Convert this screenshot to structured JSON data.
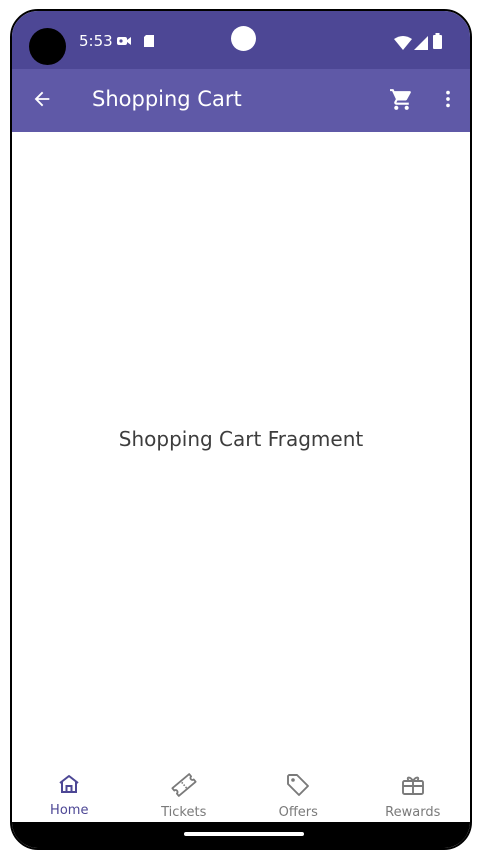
{
  "status_bar": {
    "time": "5:53",
    "left_icons": [
      "media-icon",
      "sd-card-icon"
    ],
    "right_icons": [
      "wifi-icon",
      "signal-icon",
      "battery-icon"
    ]
  },
  "app_bar": {
    "title": "Shopping Cart",
    "back_icon": "arrow-left-icon",
    "actions": [
      "cart-icon",
      "more-vert-icon"
    ]
  },
  "content": {
    "text": "Shopping Cart Fragment"
  },
  "bottom_nav": {
    "items": [
      {
        "label": "Home",
        "icon": "home-icon",
        "active": true
      },
      {
        "label": "Tickets",
        "icon": "ticket-icon",
        "active": false
      },
      {
        "label": "Offers",
        "icon": "tag-icon",
        "active": false
      },
      {
        "label": "Rewards",
        "icon": "gift-icon",
        "active": false
      }
    ]
  },
  "colors": {
    "status_bar": "#4d4795",
    "app_bar": "#5f59a7",
    "active_nav": "#4d4795",
    "inactive_nav": "#7a7a7a"
  }
}
